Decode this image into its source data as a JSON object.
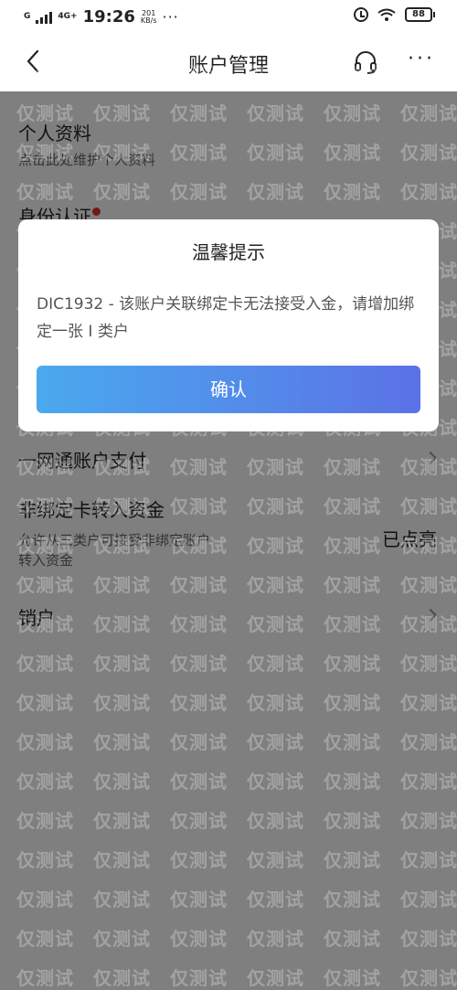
{
  "status_bar": {
    "network_top": "4G+",
    "network_label": "G",
    "time": "19:26",
    "speed_value": "201",
    "speed_unit": "KB/s",
    "more": "···",
    "battery": "88"
  },
  "nav": {
    "title": "账户管理",
    "more": "···"
  },
  "list": {
    "profile_title": "个人资料",
    "profile_sub": "点击此处维护个人资料",
    "identity_title": "身份认证",
    "network_pay_title": "一网通账户支付",
    "nonbound_title": "非绑定卡转入资金",
    "nonbound_sub_line1": "允许从三类户可接受非绑定账户",
    "nonbound_sub_line2": "转入资金",
    "nonbound_status": "已点亮",
    "close_title": "销户"
  },
  "dialog": {
    "title": "温馨提示",
    "message": "DIC1932 - 该账户关联绑定卡无法接受入金，请增加绑定一张 I 类户",
    "confirm_label": "确认"
  },
  "watermark": {
    "text": "仅测试"
  },
  "colors": {
    "accent_start": "#4aa9ee",
    "accent_end": "#5b72e6",
    "red_dot": "#e5302d",
    "overlay": "rgba(0,0,0,0.5)"
  }
}
